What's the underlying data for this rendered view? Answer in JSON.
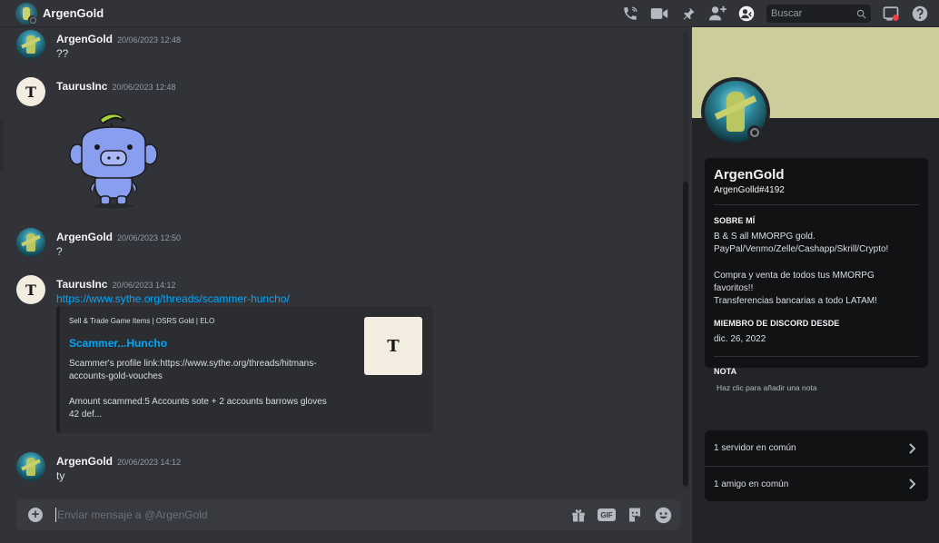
{
  "header": {
    "title": "ArgenGold",
    "search_placeholder": "Buscar",
    "icons": [
      "phone-call-icon",
      "video-call-icon",
      "pin-icon",
      "add-friend-icon",
      "profile-toggle-icon",
      "search-icon",
      "inbox-icon",
      "help-icon"
    ]
  },
  "messages": [
    {
      "author": "ArgenGold",
      "time": "20/06/2023 12:48",
      "text": "??"
    },
    {
      "author": "TaurusInc",
      "time": "20/06/2023 12:48",
      "sticker": "wumpus-banana"
    },
    {
      "author": "ArgenGold",
      "time": "20/06/2023 12:50",
      "text": "?"
    },
    {
      "author": "TaurusInc",
      "time": "20/06/2023 14:12",
      "link": "https://www.sythe.org/threads/scammer-huncho/"
    },
    {
      "author": "ArgenGold",
      "time": "20/06/2023 14:12",
      "text": "ty"
    }
  ],
  "embed": {
    "provider": "Sell & Trade Game Items | OSRS Gold | ELO",
    "title": "Scammer...Huncho",
    "description": "Scammer's profile link:https://www.sythe.org/threads/hitmans-\naccounts-gold-vouches\n\nAmount scammed:5 Accounts sote + 2 accounts barrows gloves\n42 def..."
  },
  "avatars": {
    "taurus_letter": "T",
    "thumb_letter": "T"
  },
  "composer": {
    "placeholder": "Enviar mensaje a @ArgenGold",
    "plus": "+",
    "gif": "GIF"
  },
  "profile": {
    "name": "ArgenGold",
    "tag": "ArgenGolld#4192",
    "about_header": "SOBRE MÍ",
    "about": "B & S all MMORPG gold.\nPayPal/Venmo/Zelle/Cashapp/Skrill/Crypto!\n\nCompra y venta de todos tus MMORPG\nfavoritos!!\nTransferencias bancarias a todo LATAM!",
    "member_header": "MIEMBRO DE DISCORD DESDE",
    "member_since": "dic. 26, 2022",
    "note_header": "NOTA",
    "note_placeholder": "Haz clic para añadir una nota",
    "mutual_servers": "1 servidor en común",
    "mutual_friends": "1 amigo en común"
  },
  "colors": {
    "background": "#313338",
    "panel": "#232428",
    "banner": "#cdcc9b",
    "link": "#00a8fc"
  }
}
